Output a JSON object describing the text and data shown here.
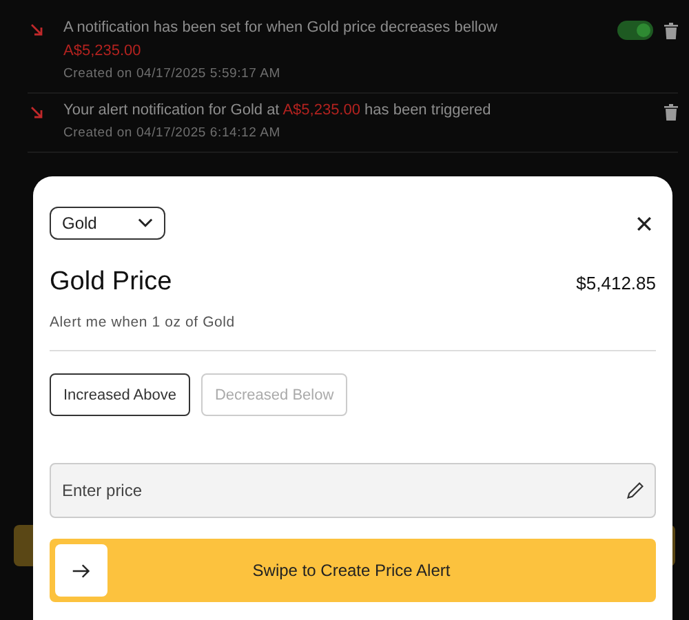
{
  "notifications": [
    {
      "kind": "scheduled",
      "enabled": true,
      "text_before": "A notification has been set for when Gold price decreases bellow",
      "highlight": "A$5,235.00",
      "created": "Created on 04/17/2025 5:59:17 AM"
    },
    {
      "kind": "triggered",
      "text_before": "Your alert notification for Gold at",
      "highlight": "A$5,235.00",
      "text_after": "has been triggered",
      "created": "Created on 04/17/2025 6:14:12 AM"
    }
  ],
  "modal": {
    "asset_select": "Gold",
    "title": "Gold Price",
    "price": "$5,412.85",
    "subtitle": "Alert me when 1 oz of Gold",
    "directions": [
      {
        "label": "Increased Above",
        "selected": true
      },
      {
        "label": "Decreased Below",
        "selected": false
      }
    ],
    "price_field": {
      "placeholder": "Enter price"
    },
    "swipe_label": "Swipe to Create Price Alert",
    "swipe": {
      "level": 0
    }
  }
}
